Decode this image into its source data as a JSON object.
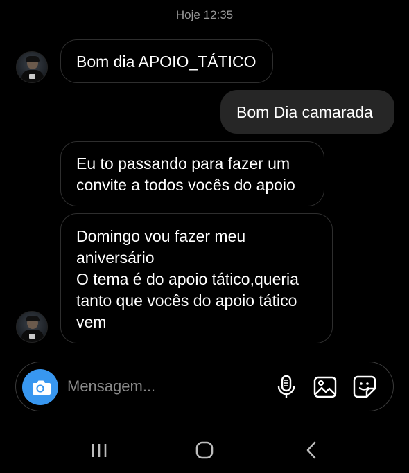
{
  "timestamp": "Hoje 12:35",
  "messages": [
    {
      "direction": "incoming",
      "text": "Bom dia APOIO_TÁTICO"
    },
    {
      "direction": "outgoing",
      "text": "Bom Dia camarada"
    },
    {
      "direction": "incoming",
      "text": "Eu to passando para fazer um\nconvite a todos vocês do apoio"
    },
    {
      "direction": "incoming",
      "text": "Domingo vou fazer meu\naniversário\nO tema é do apoio tático,queria\ntanto que vocês do apoio tático\nvem"
    }
  ],
  "composer": {
    "placeholder": "Mensagem...",
    "icons": [
      "camera-icon",
      "microphone-icon",
      "gallery-icon",
      "sticker-icon"
    ],
    "accent_color": "#3897f0"
  },
  "navbar": {
    "icons": [
      "recent-apps-icon",
      "home-icon",
      "back-icon"
    ]
  }
}
